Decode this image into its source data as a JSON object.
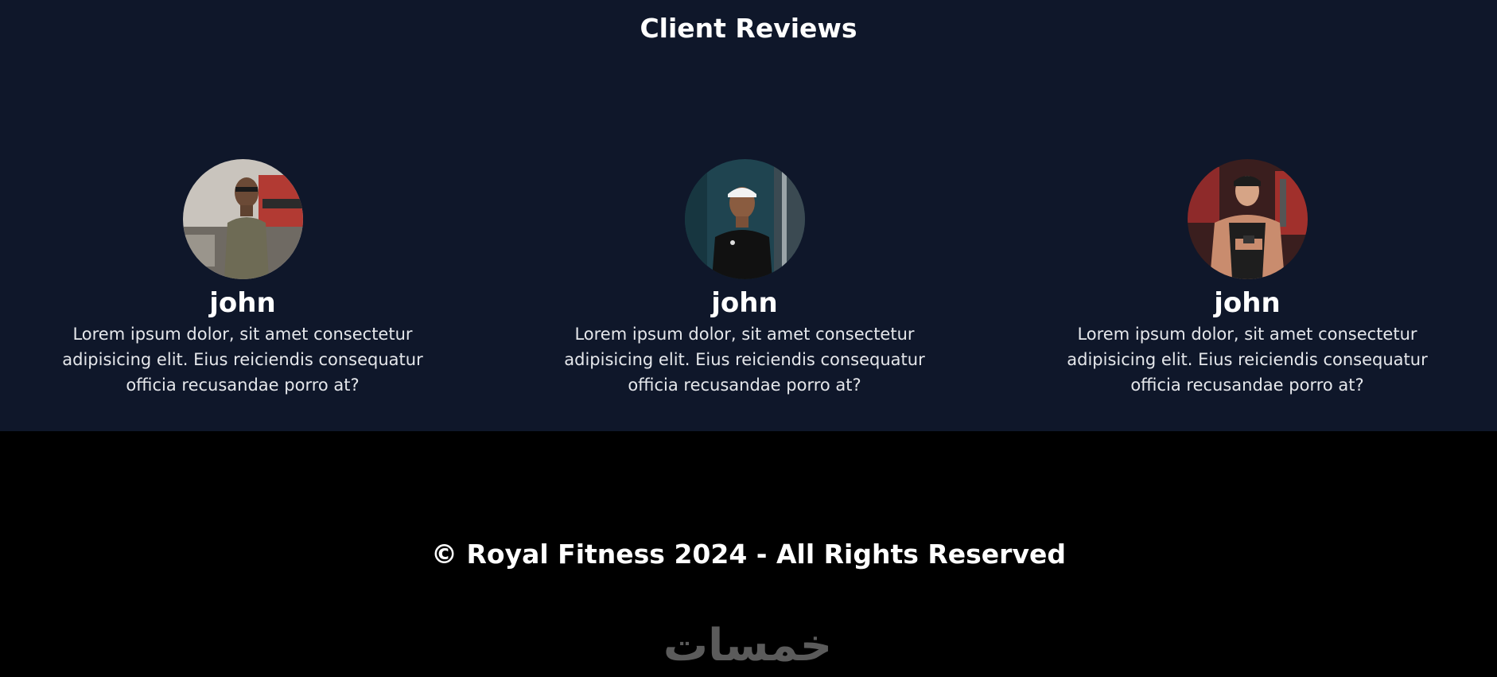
{
  "reviews": {
    "title": "Client Reviews",
    "items": [
      {
        "name": "john",
        "text": "Lorem ipsum dolor, sit amet consectetur adipisicing elit. Eius reiciendis consequatur officia recusandae porro at?"
      },
      {
        "name": "john",
        "text": "Lorem ipsum dolor, sit amet consectetur adipisicing elit. Eius reiciendis consequatur officia recusandae porro at?"
      },
      {
        "name": "john",
        "text": "Lorem ipsum dolor, sit amet consectetur adipisicing elit. Eius reiciendis consequatur officia recusandae porro at?"
      }
    ]
  },
  "footer": {
    "copyright": "© Royal Fitness 2024 - All Rights Reserved",
    "watermark": "خمسات"
  },
  "colors": {
    "reviews_bg": "#0f172a",
    "footer_bg": "#000000",
    "text": "#ffffff"
  }
}
